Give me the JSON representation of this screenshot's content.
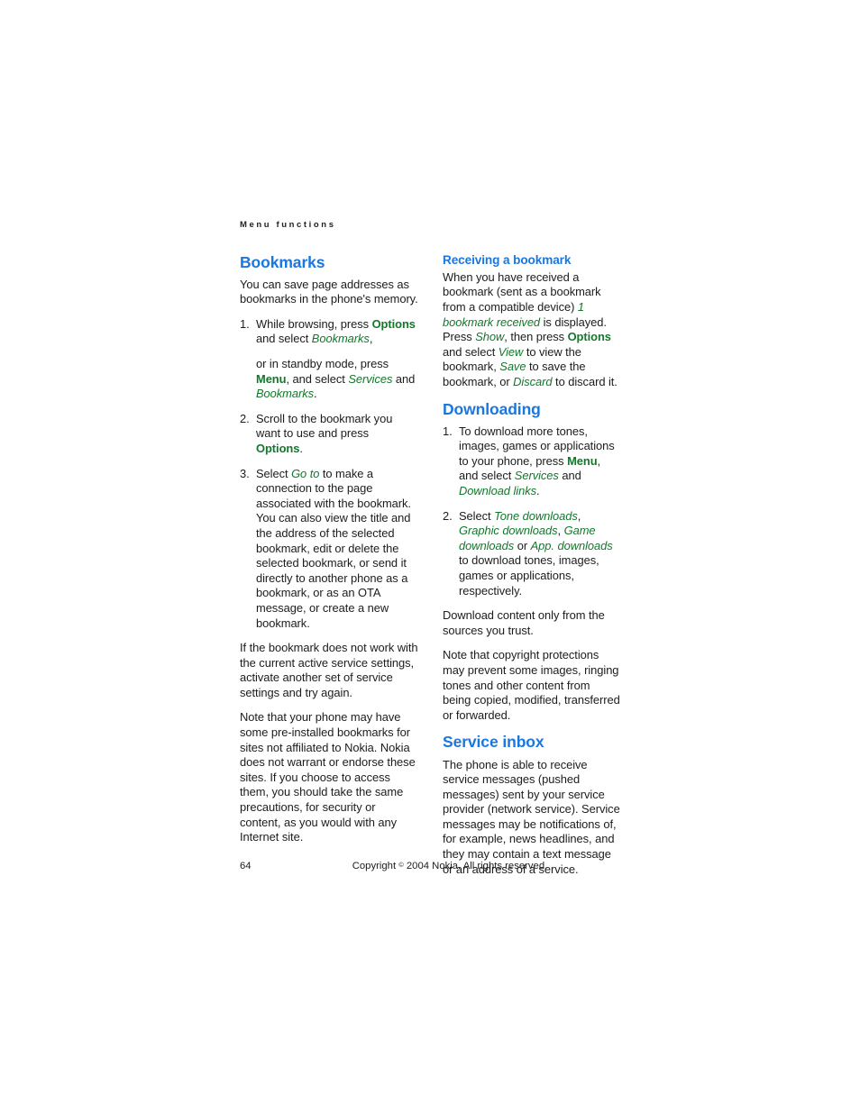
{
  "running_head": "Menu functions",
  "left_column": {
    "heading": "Bookmarks",
    "intro": "You can save page addresses as bookmarks in the phone's memory.",
    "steps": [
      {
        "num": "1.",
        "part1_a": "While browsing, press ",
        "part1_key": "Options",
        "part1_b": " and select ",
        "part1_menu": "Bookmarks",
        "part1_c": ",",
        "part2_a": "or in standby mode, press ",
        "part2_key": "Menu",
        "part2_b": ", and select ",
        "part2_menu": "Services",
        "part2_c": " and ",
        "part2_menu2": "Bookmarks",
        "part2_d": "."
      },
      {
        "num": "2.",
        "text_a": "Scroll to the bookmark you want to use and press ",
        "key": "Options",
        "text_b": "."
      },
      {
        "num": "3.",
        "text_a": "Select ",
        "menu": "Go to",
        "text_b": " to make a connection to the page associated with the bookmark. You can also view the title and the address of the selected bookmark, edit or delete the selected bookmark, or send it directly to another phone as a bookmark, or as an OTA message, or create a new bookmark."
      }
    ],
    "para_fallback": "If the bookmark does not work with the current active service settings, activate another set of service settings and try again.",
    "para_preinstalled": "Note that your phone may have some pre-installed bookmarks for sites not affiliated to Nokia. Nokia does not warrant or endorse these sites. If you choose to access them, you should take the same precautions, for security or content, as you would with any Internet site."
  },
  "right_column": {
    "receiving": {
      "heading": "Receiving a bookmark",
      "p_a": "When you have received a bookmark (sent as a bookmark from a compatible device) ",
      "p_menu1": "1 bookmark received",
      "p_b": " is displayed. Press ",
      "p_menu2": "Show",
      "p_c": ", then press ",
      "p_key": "Options",
      "p_d": " and select ",
      "p_menu3": "View",
      "p_e": " to view the bookmark, ",
      "p_menu4": "Save",
      "p_f": " to save the bookmark, or ",
      "p_menu5": "Discard",
      "p_g": " to discard it."
    },
    "downloading": {
      "heading": "Downloading",
      "steps": [
        {
          "num": "1.",
          "text_a": "To download more tones, images, games or applications to your phone, press ",
          "key": "Menu",
          "text_b": ", and select ",
          "menu1": "Services",
          "text_c": " and ",
          "menu2": "Download links",
          "text_d": "."
        },
        {
          "num": "2.",
          "text_a": "Select ",
          "menu1": "Tone downloads",
          "text_b": ", ",
          "menu2": "Graphic downloads",
          "text_c": ", ",
          "menu3": "Game downloads",
          "text_d": " or ",
          "menu4": "App. downloads",
          "text_e": " to download tones, images, games or applications, respectively."
        }
      ],
      "para_trust": "Download content only from the sources you trust.",
      "para_copyright": "Note that copyright protections may prevent some images, ringing tones and other content from being copied, modified, transferred or forwarded."
    },
    "service_inbox": {
      "heading": "Service inbox",
      "para": "The phone is able to receive service messages (pushed messages) sent by your service provider (network service). Service messages may be notifications of, for example, news headlines, and they may contain a text message or an address of a service."
    }
  },
  "footer": {
    "page_number": "64",
    "copyright_before": "Copyright ",
    "copyright_symbol": "©",
    "copyright_after": " 2004 Nokia. All rights reserved."
  },
  "colors": {
    "heading_blue": "#1a77e0",
    "accent_green": "#13772b",
    "body_text": "#1c1c1c",
    "background": "#ffffff"
  }
}
